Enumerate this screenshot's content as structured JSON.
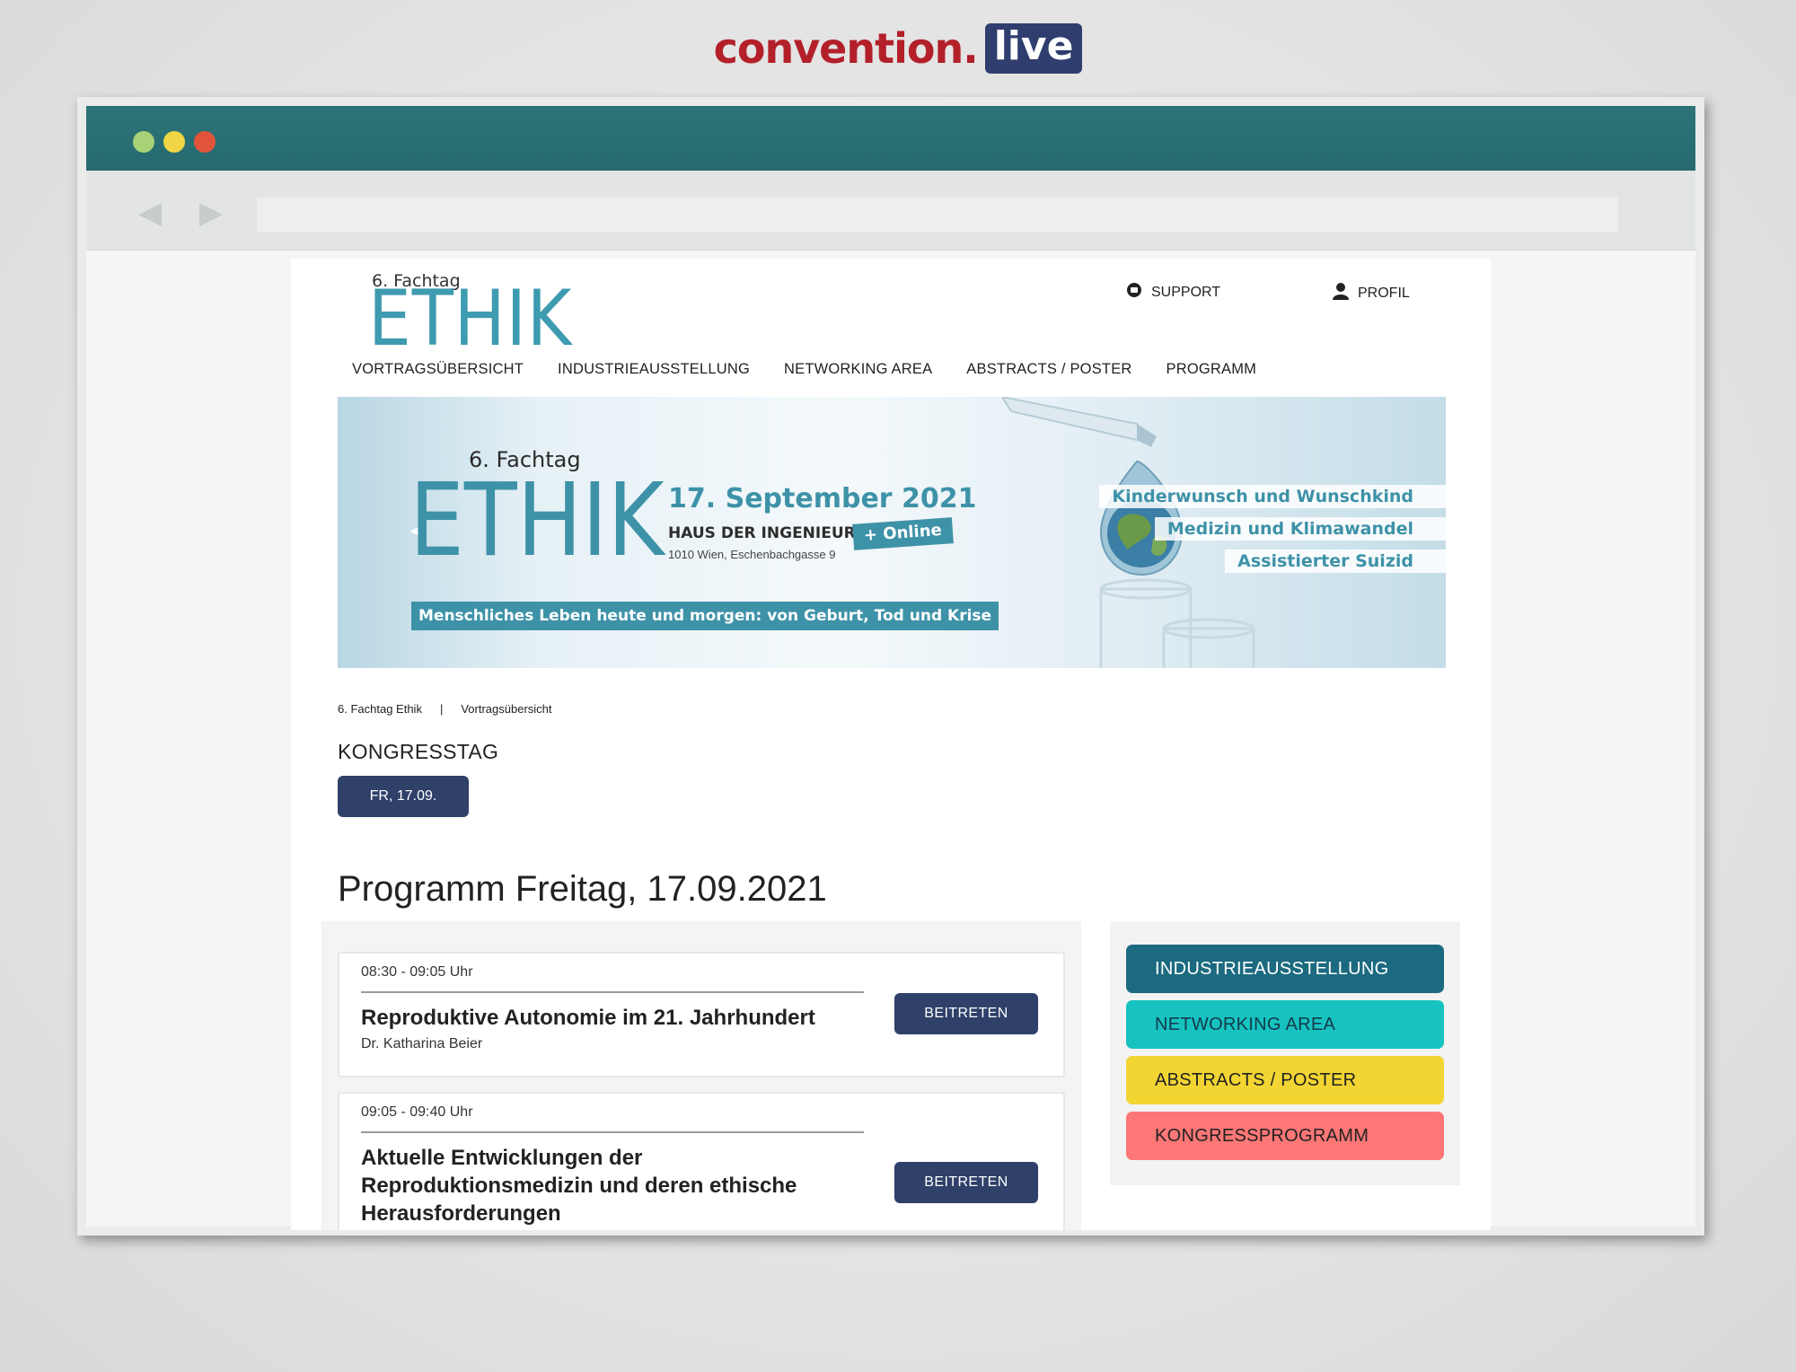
{
  "brand": {
    "word": "convention.",
    "badge": "live"
  },
  "header": {
    "logo_small": "6. Fachtag",
    "logo_big": "ETHIK",
    "support_label": "SUPPORT",
    "profil_label": "PROFIL"
  },
  "nav": {
    "items": [
      {
        "label": "VORTRAGSÜBERSICHT"
      },
      {
        "label": "INDUSTRIEAUSSTELLUNG"
      },
      {
        "label": "NETWORKING AREA"
      },
      {
        "label": "ABSTRACTS / POSTER"
      },
      {
        "label": "PROGRAMM"
      }
    ]
  },
  "banner": {
    "small": "6. Fachtag",
    "big": "ETHIK",
    "date": "17. September 2021",
    "venue": "HAUS DER INGENIEURE",
    "address": "1010 Wien, Eschenbachgasse 9",
    "online": "+ Online",
    "tagline": "Menschliches Leben heute und morgen: von Geburt, Tod und Krise",
    "topics": [
      "Kinderwunsch und Wunschkind",
      "Medizin und Klimawandel",
      "Assistierter Suizid"
    ]
  },
  "breadcrumb": {
    "root": "6. Fachtag Ethik",
    "separator": "|",
    "current": "Vortragsübersicht"
  },
  "kongresstag": {
    "label": "KONGRESSTAG",
    "day": "FR, 17.09."
  },
  "program": {
    "title": "Programm Freitag, 17.09.2021",
    "sessions": [
      {
        "time": "08:30 - 09:05 Uhr",
        "title": "Reproduktive Autonomie im 21. Jahrhundert",
        "speaker": "Dr. Katharina Beier",
        "button": "BEITRETEN"
      },
      {
        "time": "09:05 - 09:40 Uhr",
        "title": "Aktuelle Entwicklungen der Reproduktionsmedizin und deren ethische Herausforderungen",
        "speaker": "",
        "button": "BEITRETEN"
      }
    ]
  },
  "quicklinks": [
    {
      "label": "INDUSTRIEAUSSTELLUNG",
      "color": "#1c6a80"
    },
    {
      "label": "NETWORKING AREA",
      "color": "#16c3c0"
    },
    {
      "label": "ABSTRACTS / POSTER",
      "color": "#f2d533"
    },
    {
      "label": "KONGRESSPROGRAMM",
      "color": "#fd7777"
    }
  ],
  "colors": {
    "accent": "#3e92a8",
    "primary_button": "#2f4069",
    "brand_red": "#b3202a",
    "titlebar": "#2c7478"
  }
}
